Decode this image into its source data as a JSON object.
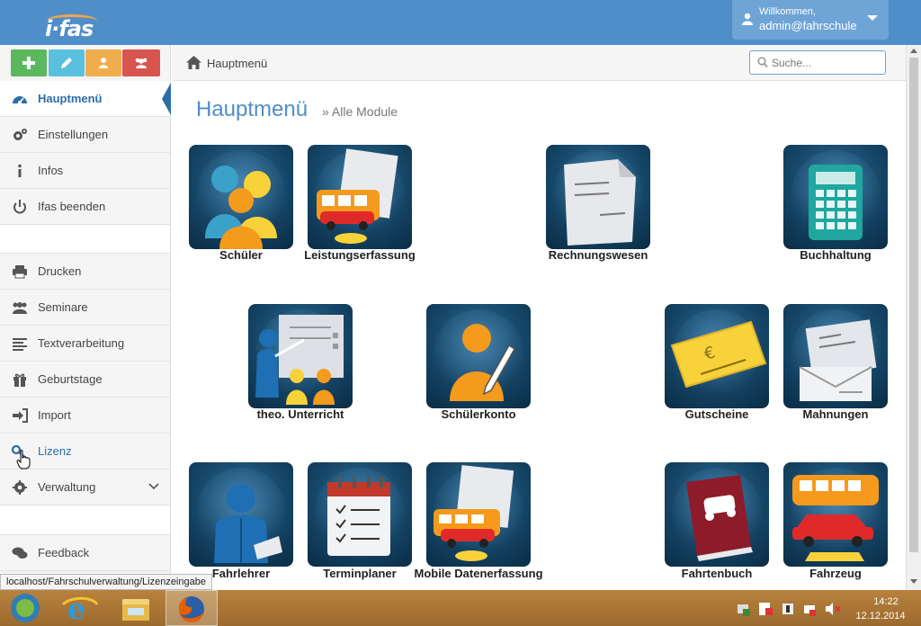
{
  "app": {
    "logo_text": "i·fas",
    "user": {
      "welcome": "Willkommen,",
      "name": "admin@fahrschule"
    }
  },
  "quick_buttons": [
    {
      "name": "add",
      "color": "#5cb85c"
    },
    {
      "name": "edit",
      "color": "#5bc0de"
    },
    {
      "name": "user",
      "color": "#f0ad4e"
    },
    {
      "name": "group",
      "color": "#d9534f"
    }
  ],
  "sidebar": {
    "items": [
      {
        "label": "Hauptmenü",
        "icon": "dashboard-icon",
        "active": true
      },
      {
        "label": "Einstellungen",
        "icon": "gears-icon"
      },
      {
        "label": "Infos",
        "icon": "info-icon"
      },
      {
        "label": "Ifas beenden",
        "icon": "power-icon"
      },
      {
        "label": "Drucken",
        "icon": "print-icon"
      },
      {
        "label": "Seminare",
        "icon": "group-icon"
      },
      {
        "label": "Textverarbeitung",
        "icon": "text-lines-icon"
      },
      {
        "label": "Geburtstage",
        "icon": "gift-icon"
      },
      {
        "label": "Import",
        "icon": "import-icon"
      },
      {
        "label": "Lizenz",
        "icon": "key-icon"
      },
      {
        "label": "Verwaltung",
        "icon": "gear-icon",
        "has_submenu": true
      },
      {
        "label": "Feedback",
        "icon": "comments-icon"
      }
    ]
  },
  "breadcrumb": {
    "home": "Hauptmenü"
  },
  "search": {
    "placeholder": "Suche..."
  },
  "main": {
    "title": "Hauptmenü",
    "subtitle": "» Alle Module",
    "modules": [
      {
        "label": "Schüler",
        "icon": "students-icon"
      },
      {
        "label": "Leistungserfassung",
        "icon": "performance-capture-icon"
      },
      {
        "label": "Rechnungswesen",
        "icon": "invoices-icon"
      },
      {
        "label": "Buchhaltung",
        "icon": "calculator-icon"
      },
      {
        "label": "theo. Unterricht",
        "icon": "theory-class-icon"
      },
      {
        "label": "Schülerkonto",
        "icon": "student-account-icon"
      },
      {
        "label": "Gutscheine",
        "icon": "voucher-icon"
      },
      {
        "label": "Mahnungen",
        "icon": "reminder-letter-icon"
      },
      {
        "label": "Fahrlehrer",
        "icon": "instructor-icon"
      },
      {
        "label": "Terminplaner",
        "icon": "calendar-checklist-icon"
      },
      {
        "label": "Mobile Datenerfassung",
        "icon": "mobile-data-capture-icon"
      },
      {
        "label": "Fahrtenbuch",
        "icon": "logbook-icon"
      },
      {
        "label": "Fahrzeug",
        "icon": "vehicles-icon"
      }
    ]
  },
  "status_url": "localhost/Fahrschulverwaltung/Lizenzeingabe",
  "taskbar": {
    "apps": [
      "start-orb",
      "internet-explorer",
      "file-explorer",
      "firefox"
    ],
    "time": "14:22",
    "date": "12.12.2014"
  }
}
